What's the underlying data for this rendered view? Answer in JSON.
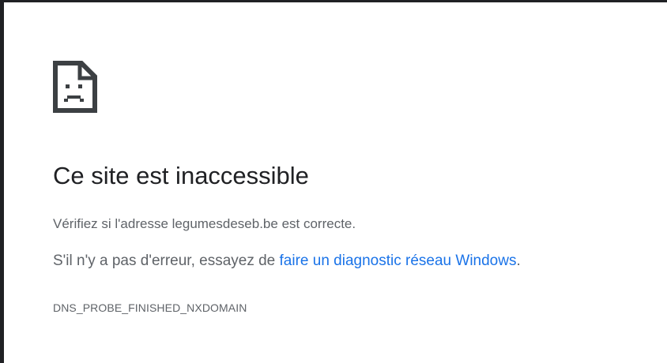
{
  "error_page": {
    "icon": "sad-page-icon",
    "title": "Ce site est inaccessible",
    "message": "Vérifiez si l'adresse legumesdeseb.be est correcte.",
    "suggestion_prefix": "S'il n'y a pas d'erreur, essayez de ",
    "suggestion_link": "faire un diagnostic réseau Windows",
    "suggestion_suffix": ".",
    "error_code": "DNS_PROBE_FINISHED_NXDOMAIN"
  },
  "colors": {
    "title": "#202124",
    "text": "#5f6368",
    "link": "#1a73e8",
    "icon": "#3c4043",
    "frame": "#202124"
  }
}
